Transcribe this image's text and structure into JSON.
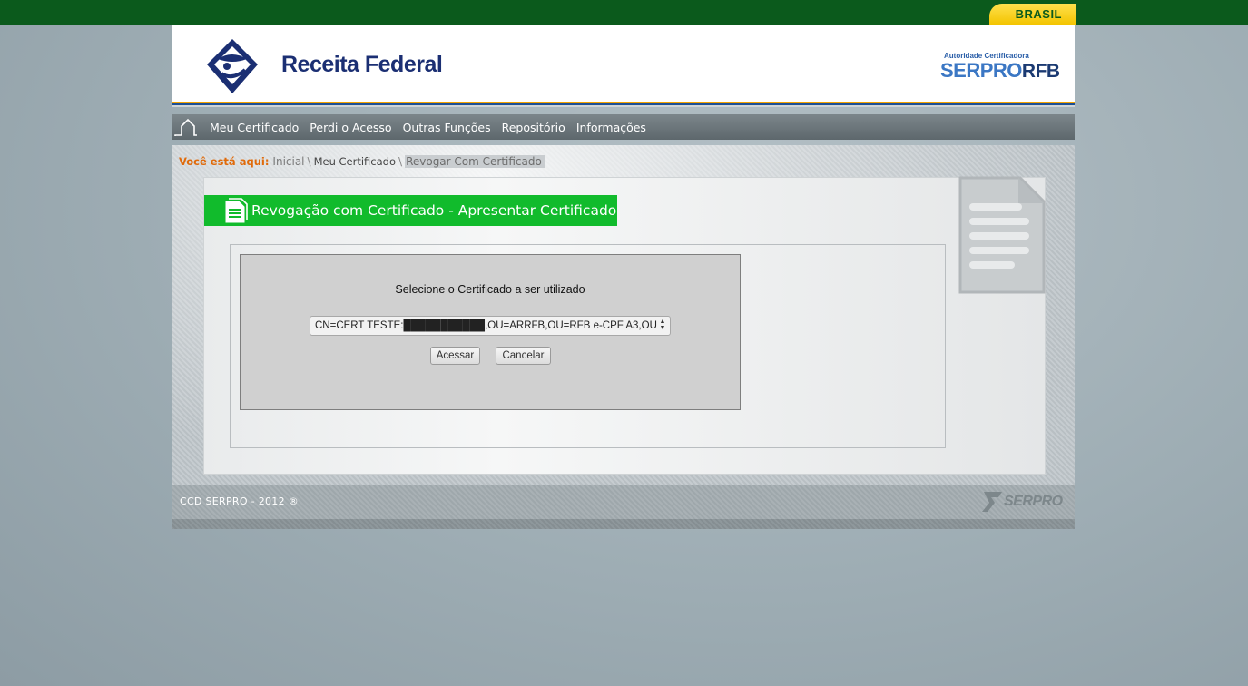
{
  "gov_bar": {
    "badge": "BRASIL"
  },
  "header": {
    "logo_title": "Receita Federal",
    "serpro_subtitle": "Autoridade Certificadora",
    "serpro_name": "SERPRO",
    "serpro_suffix": "RFB"
  },
  "nav": {
    "items": [
      {
        "label": "Meu Certificado"
      },
      {
        "label": "Perdi o Acesso"
      },
      {
        "label": "Outras Funções"
      },
      {
        "label": "Repositório"
      },
      {
        "label": "Informações"
      }
    ]
  },
  "breadcrumb": {
    "label": "Você está aqui:",
    "items": [
      "Inicial",
      "Meu Certificado",
      "Revogar Com Certificado"
    ],
    "separator": "\\"
  },
  "page": {
    "title": "Revogação com Certificado - Apresentar Certificado"
  },
  "dialog": {
    "prompt": "Selecione o Certificado a ser utilizado",
    "certificate_selected": "CN=CERT TESTE:███████████,OU=ARRFB,OU=RFB e-CPF A3,OU",
    "accept_label": "Acessar",
    "cancel_label": "Cancelar"
  },
  "footer": {
    "copyright": "CCD SERPRO - 2012 ®",
    "logo_text": "SERPRO"
  },
  "colors": {
    "gov_green": "#0b5a1c",
    "badge_yellow": "#f3c400",
    "title_green": "#11bb2c",
    "breadcrumb_orange": "#e06a0a",
    "rf_blue": "#1b2f73"
  }
}
